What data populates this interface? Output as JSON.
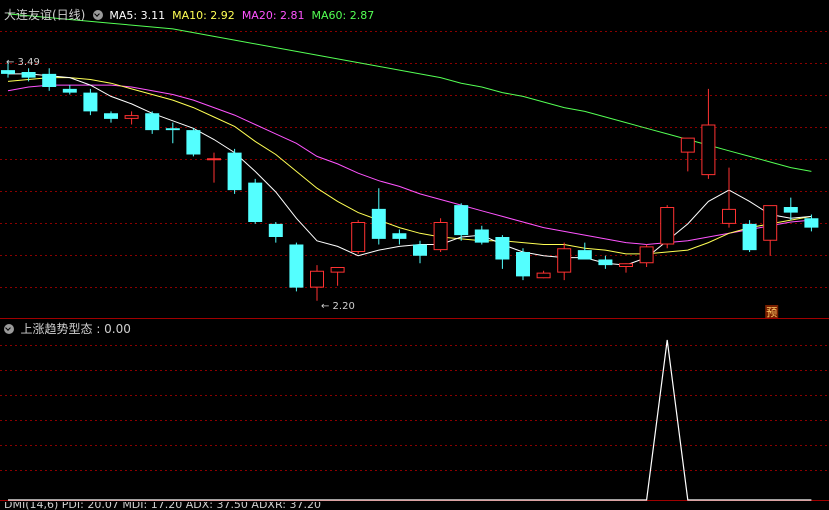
{
  "header": {
    "title": "大连友谊(日线)",
    "ma5": "MA5: 3.11",
    "ma10": "MA10: 2.92",
    "ma20": "MA20: 2.81",
    "ma60": "MA60: 2.87"
  },
  "indicator": {
    "label": "上涨趋势型态 : 0.00"
  },
  "bottom_bar": {
    "text": "DMI(14,6) PDI: 20.07  MDI: 17.20  ADX: 37.50  ADXR: 37.20"
  },
  "annotations": {
    "high_label": "3.49",
    "low_label": "2.20",
    "forecast_badge": "预"
  },
  "colors": {
    "up": "#ff3232",
    "down": "#54ffff",
    "ma5": "#ffffff",
    "ma10": "#ffff54",
    "ma20": "#ff54ff",
    "ma60": "#54ff54",
    "grid": "#8b0000"
  },
  "chart_data": [
    {
      "type": "candlestick",
      "title": "大连友谊(日线)",
      "ylim": [
        2.15,
        3.75
      ],
      "candles": [
        {
          "o": 3.44,
          "h": 3.49,
          "l": 3.4,
          "c": 3.42
        },
        {
          "o": 3.43,
          "h": 3.45,
          "l": 3.38,
          "c": 3.4
        },
        {
          "o": 3.42,
          "h": 3.45,
          "l": 3.33,
          "c": 3.35
        },
        {
          "o": 3.34,
          "h": 3.36,
          "l": 3.31,
          "c": 3.32
        },
        {
          "o": 3.32,
          "h": 3.34,
          "l": 3.2,
          "c": 3.22
        },
        {
          "o": 3.21,
          "h": 3.22,
          "l": 3.16,
          "c": 3.18
        },
        {
          "o": 3.18,
          "h": 3.22,
          "l": 3.15,
          "c": 3.2
        },
        {
          "o": 3.21,
          "h": 3.22,
          "l": 3.1,
          "c": 3.12
        },
        {
          "o": 3.13,
          "h": 3.16,
          "l": 3.05,
          "c": 3.12
        },
        {
          "o": 3.12,
          "h": 3.13,
          "l": 2.98,
          "c": 2.99
        },
        {
          "o": 2.96,
          "h": 3.0,
          "l": 2.84,
          "c": 2.97
        },
        {
          "o": 3.0,
          "h": 3.02,
          "l": 2.78,
          "c": 2.8
        },
        {
          "o": 2.84,
          "h": 2.86,
          "l": 2.62,
          "c": 2.63
        },
        {
          "o": 2.62,
          "h": 2.63,
          "l": 2.52,
          "c": 2.55
        },
        {
          "o": 2.51,
          "h": 2.52,
          "l": 2.26,
          "c": 2.28
        },
        {
          "o": 2.28,
          "h": 2.4,
          "l": 2.21,
          "c": 2.37
        },
        {
          "o": 2.36,
          "h": 2.39,
          "l": 2.29,
          "c": 2.39
        },
        {
          "o": 2.47,
          "h": 2.64,
          "l": 2.46,
          "c": 2.63
        },
        {
          "o": 2.7,
          "h": 2.81,
          "l": 2.51,
          "c": 2.54
        },
        {
          "o": 2.57,
          "h": 2.59,
          "l": 2.51,
          "c": 2.54
        },
        {
          "o": 2.51,
          "h": 2.53,
          "l": 2.41,
          "c": 2.45
        },
        {
          "o": 2.48,
          "h": 2.65,
          "l": 2.47,
          "c": 2.63
        },
        {
          "o": 2.72,
          "h": 2.73,
          "l": 2.53,
          "c": 2.56
        },
        {
          "o": 2.59,
          "h": 2.61,
          "l": 2.51,
          "c": 2.52
        },
        {
          "o": 2.55,
          "h": 2.56,
          "l": 2.38,
          "c": 2.43
        },
        {
          "o": 2.47,
          "h": 2.49,
          "l": 2.32,
          "c": 2.34
        },
        {
          "o": 2.33,
          "h": 2.37,
          "l": 2.33,
          "c": 2.36
        },
        {
          "o": 2.36,
          "h": 2.52,
          "l": 2.32,
          "c": 2.49
        },
        {
          "o": 2.48,
          "h": 2.52,
          "l": 2.43,
          "c": 2.43
        },
        {
          "o": 2.43,
          "h": 2.45,
          "l": 2.38,
          "c": 2.4
        },
        {
          "o": 2.39,
          "h": 2.41,
          "l": 2.36,
          "c": 2.41
        },
        {
          "o": 2.41,
          "h": 2.51,
          "l": 2.39,
          "c": 2.5
        },
        {
          "o": 2.51,
          "h": 2.72,
          "l": 2.49,
          "c": 2.71
        },
        {
          "o": 3.0,
          "h": 3.02,
          "l": 2.9,
          "c": 3.08
        },
        {
          "o": 2.88,
          "h": 3.34,
          "l": 2.86,
          "c": 3.15
        },
        {
          "o": 2.62,
          "h": 2.92,
          "l": 2.6,
          "c": 2.7
        },
        {
          "o": 2.62,
          "h": 2.64,
          "l": 2.47,
          "c": 2.48
        },
        {
          "o": 2.53,
          "h": 2.7,
          "l": 2.45,
          "c": 2.72
        },
        {
          "o": 2.71,
          "h": 2.76,
          "l": 2.64,
          "c": 2.68
        },
        {
          "o": 2.65,
          "h": 2.67,
          "l": 2.58,
          "c": 2.6
        }
      ],
      "ma5": [
        3.42,
        3.42,
        3.41,
        3.4,
        3.36,
        3.3,
        3.26,
        3.21,
        3.17,
        3.13,
        3.07,
        3.0,
        2.9,
        2.79,
        2.65,
        2.53,
        2.5,
        2.45,
        2.48,
        2.5,
        2.51,
        2.51,
        2.55,
        2.56,
        2.51,
        2.47,
        2.45,
        2.44,
        2.44,
        2.41,
        2.4,
        2.44,
        2.53,
        2.62,
        2.74,
        2.8,
        2.74,
        2.67,
        2.65,
        2.66
      ],
      "ma10": [
        3.38,
        3.39,
        3.4,
        3.4,
        3.39,
        3.37,
        3.34,
        3.31,
        3.28,
        3.24,
        3.19,
        3.14,
        3.06,
        2.99,
        2.9,
        2.81,
        2.74,
        2.68,
        2.64,
        2.6,
        2.57,
        2.55,
        2.54,
        2.53,
        2.53,
        2.52,
        2.51,
        2.51,
        2.49,
        2.48,
        2.46,
        2.46,
        2.47,
        2.48,
        2.52,
        2.57,
        2.6,
        2.62,
        2.64,
        2.66
      ],
      "ma20": [
        3.33,
        3.35,
        3.36,
        3.36,
        3.36,
        3.36,
        3.35,
        3.33,
        3.31,
        3.28,
        3.24,
        3.2,
        3.15,
        3.1,
        3.05,
        2.98,
        2.94,
        2.89,
        2.85,
        2.82,
        2.78,
        2.75,
        2.72,
        2.69,
        2.66,
        2.63,
        2.6,
        2.58,
        2.56,
        2.54,
        2.52,
        2.51,
        2.52,
        2.53,
        2.55,
        2.57,
        2.59,
        2.61,
        2.63,
        2.64
      ],
      "ma60": [
        3.74,
        3.73,
        3.72,
        3.71,
        3.7,
        3.69,
        3.68,
        3.67,
        3.66,
        3.64,
        3.62,
        3.6,
        3.58,
        3.56,
        3.54,
        3.52,
        3.5,
        3.48,
        3.46,
        3.44,
        3.42,
        3.4,
        3.37,
        3.35,
        3.32,
        3.3,
        3.27,
        3.24,
        3.22,
        3.19,
        3.16,
        3.13,
        3.1,
        3.07,
        3.04,
        3.01,
        2.98,
        2.95,
        2.92,
        2.9
      ]
    },
    {
      "type": "line",
      "title": "上涨趋势型态",
      "ylim": [
        0,
        1
      ],
      "values": [
        0,
        0,
        0,
        0,
        0,
        0,
        0,
        0,
        0,
        0,
        0,
        0,
        0,
        0,
        0,
        0,
        0,
        0,
        0,
        0,
        0,
        0,
        0,
        0,
        0,
        0,
        0,
        0,
        0,
        0,
        0,
        0,
        1,
        0,
        0,
        0,
        0,
        0,
        0,
        0
      ]
    }
  ]
}
